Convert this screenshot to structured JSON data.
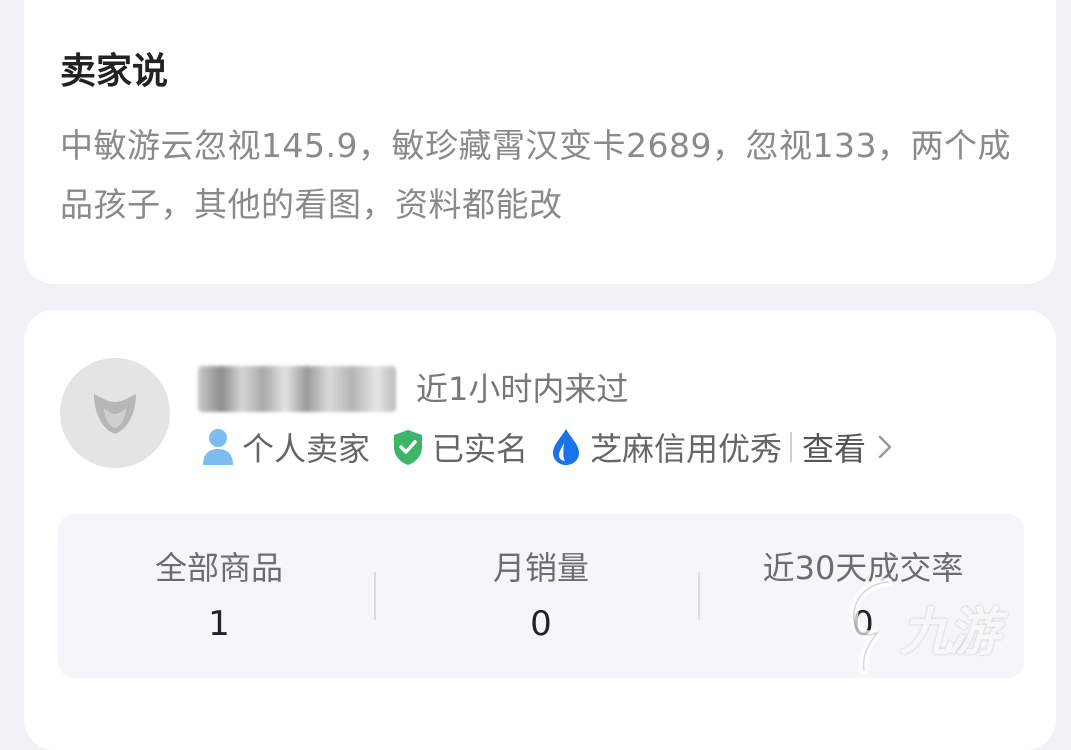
{
  "seller_says": {
    "title": "卖家说",
    "description": "中敏游云忽视145.9，敏珍藏霄汉变卡2689，忽视133，两个成品孩子，其他的看图，资料都能改"
  },
  "seller": {
    "last_seen": "近1小时内来过",
    "badges": {
      "personal": "个人卖家",
      "verified": "已实名",
      "credit": "芝麻信用优秀"
    },
    "view_label": "查看"
  },
  "stats": [
    {
      "label": "全部商品",
      "value": "1"
    },
    {
      "label": "月销量",
      "value": "0"
    },
    {
      "label": "近30天成交率",
      "value": "0"
    }
  ],
  "watermark": {
    "text": "九游"
  },
  "colors": {
    "background": "#f1f2f6",
    "card": "#ffffff",
    "person_icon": "#7bbcf1",
    "verified_icon": "#3cb56b",
    "credit_icon": "#1a73e8",
    "stats_panel": "#f5f6f9"
  },
  "icons": {
    "avatar": "fox-mask-placeholder",
    "personal": "person-icon",
    "verified": "shield-check-icon",
    "credit": "flame-drop-icon",
    "chevron": "chevron-right-icon"
  }
}
